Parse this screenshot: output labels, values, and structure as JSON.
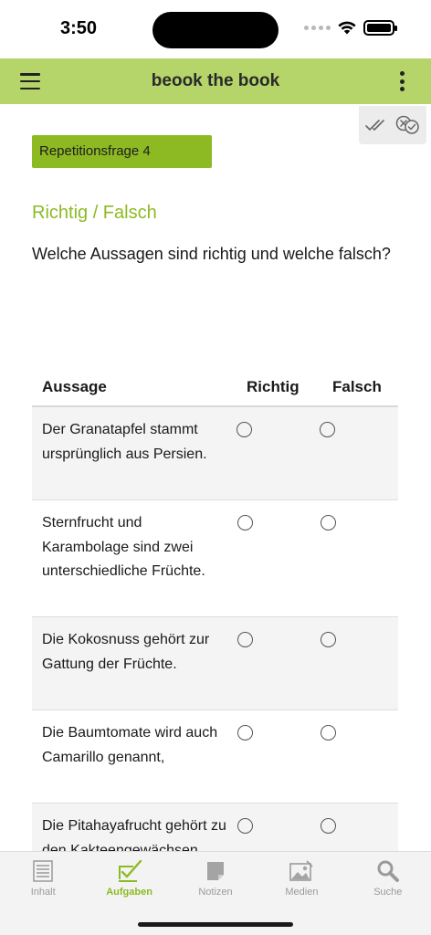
{
  "status_bar": {
    "time": "3:50"
  },
  "app_bar": {
    "title": "beook the book"
  },
  "question": {
    "tag": "Repetitionsfrage 4",
    "type": "Richtig / Falsch",
    "text": "Welche Aussagen sind richtig und welche falsch?"
  },
  "table": {
    "headers": {
      "statement": "Aussage",
      "true": "Richtig",
      "false": "Falsch"
    },
    "rows": [
      {
        "text": "Der Granatapfel stammt ursprünglich aus Persien."
      },
      {
        "text": "Sternfrucht und Karambolage sind zwei unterschiedliche Früchte."
      },
      {
        "text": "Die Kokosnuss gehört zur Gattung der Früchte."
      },
      {
        "text": "Die Baumtomate wird auch Camarillo genannt,"
      },
      {
        "text": "Die Pitahayafrucht gehört zu den Kakteengewächsen."
      }
    ]
  },
  "tab_bar": {
    "tabs": [
      {
        "label": "Inhalt",
        "icon": "list-icon",
        "active": false
      },
      {
        "label": "Aufgaben",
        "icon": "tasks-icon",
        "active": true
      },
      {
        "label": "Notizen",
        "icon": "note-icon",
        "active": false
      },
      {
        "label": "Medien",
        "icon": "image-icon",
        "active": false
      },
      {
        "label": "Suche",
        "icon": "search-icon",
        "active": false
      }
    ]
  },
  "colors": {
    "app_bar": "#b5d56a",
    "accent": "#8dba23",
    "row_alt": "#f4f4f4"
  }
}
